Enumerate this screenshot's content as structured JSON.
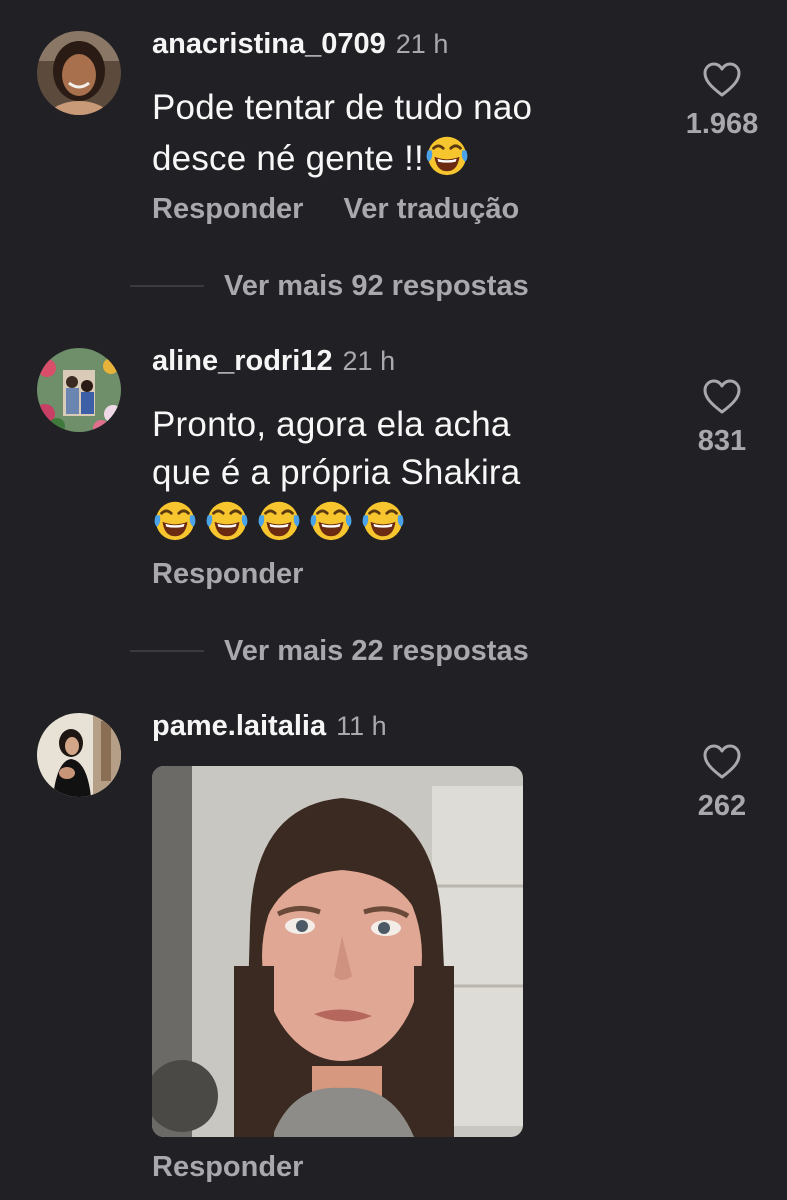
{
  "comments": [
    {
      "username": "anacristina_0709",
      "time": "21 h",
      "text_line1": "Pode tentar de tudo nao",
      "text_line2": "desce né gente !!",
      "likes": "1.968",
      "reply_label": "Responder",
      "translate_label": "Ver tradução",
      "more_replies": "Ver mais 92 respostas"
    },
    {
      "username": "aline_rodri12",
      "time": "21 h",
      "text_line1": "Pronto, agora ela acha",
      "text_line2": "que é a própria Shakira",
      "likes": "831",
      "reply_label": "Responder",
      "more_replies": "Ver mais 22 respostas"
    },
    {
      "username": "pame.laitalia",
      "time": "11 h",
      "likes": "262",
      "reply_label": "Responder"
    }
  ],
  "icons": {
    "like": "heart-outline-icon",
    "emoji": "face-with-tears-of-joy-emoji"
  },
  "colors": {
    "background": "#212125",
    "primary_text": "#f5f5f5",
    "secondary_text": "#a8a8ad"
  }
}
